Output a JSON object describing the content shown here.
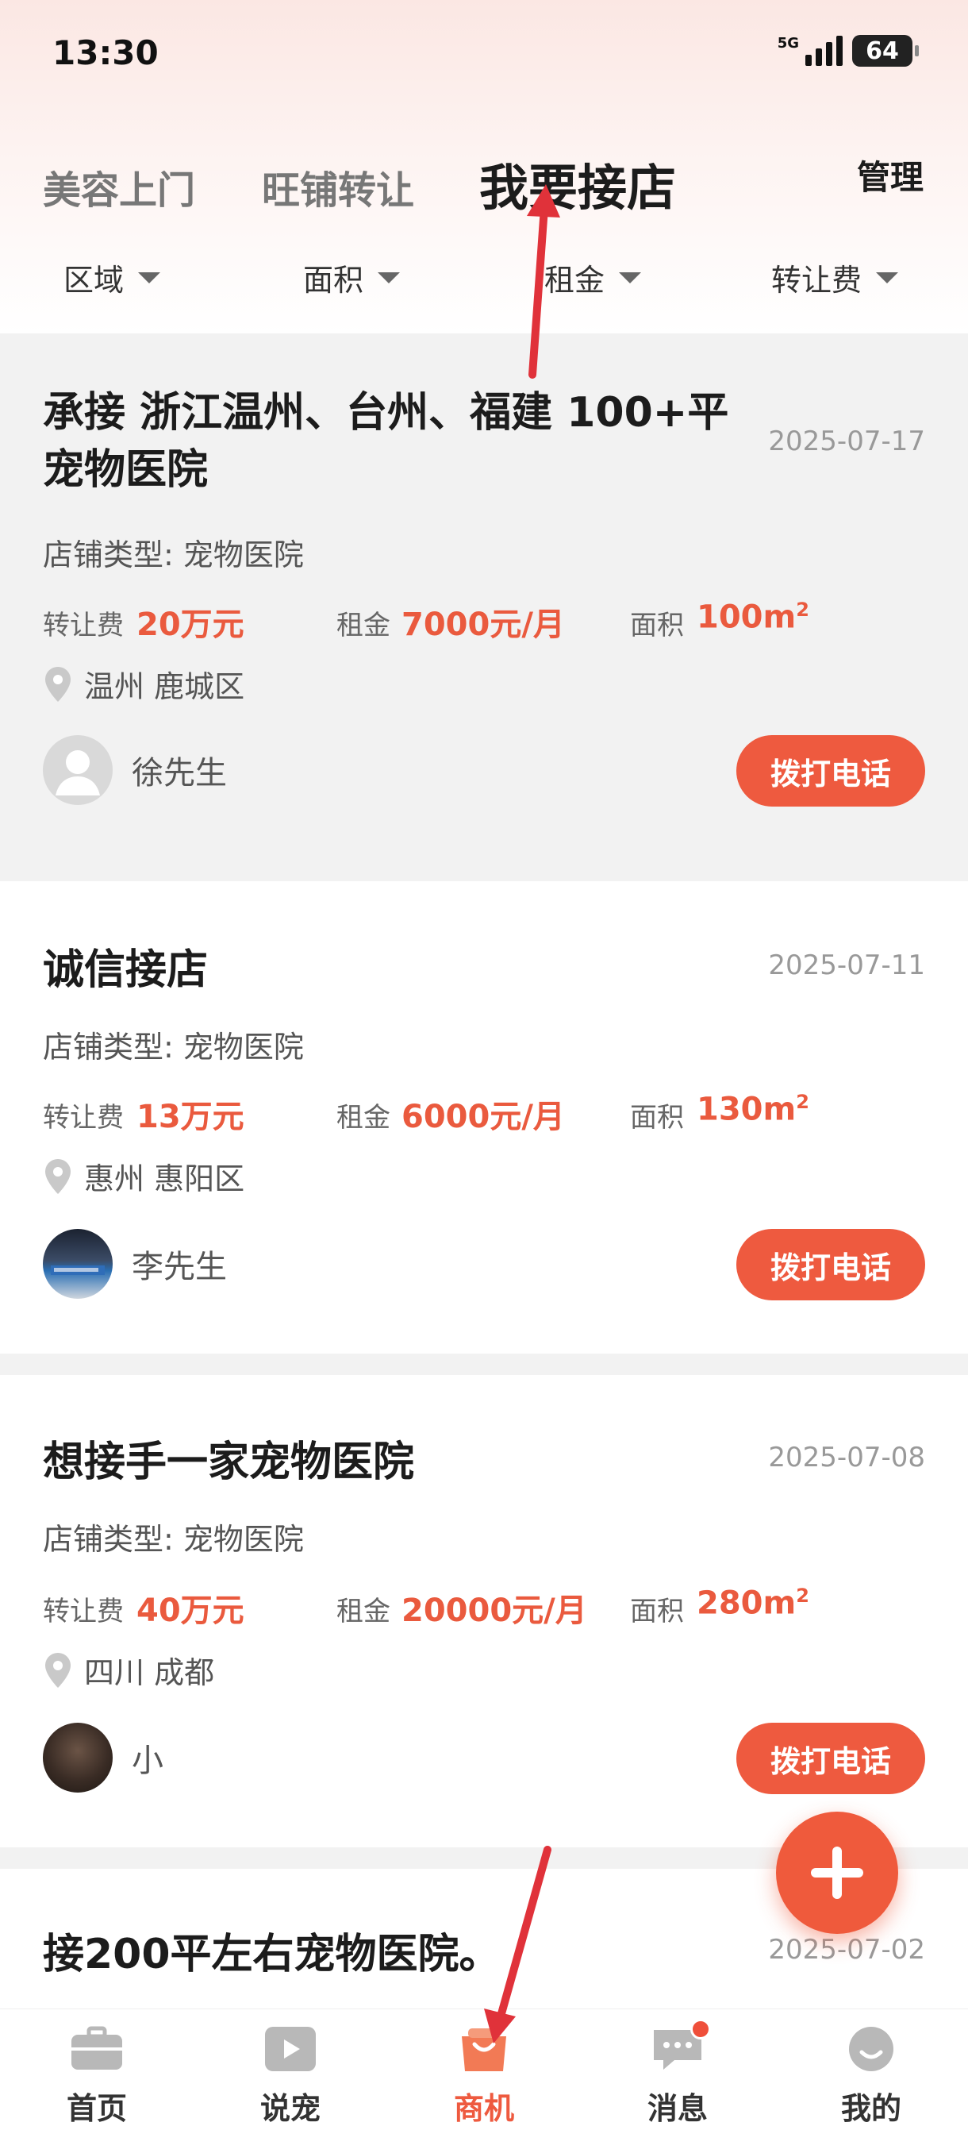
{
  "status_bar": {
    "time": "13:30",
    "network": "5G",
    "battery": "64"
  },
  "header": {
    "tabs": [
      {
        "label": "美容上门"
      },
      {
        "label": "旺铺转让"
      },
      {
        "label": "我要接店"
      }
    ],
    "manage_label": "管理"
  },
  "filters": [
    {
      "label": "区域"
    },
    {
      "label": "面积"
    },
    {
      "label": "租金"
    },
    {
      "label": "转让费"
    }
  ],
  "listings": [
    {
      "title_line1": "承接 浙江温州、台州、福建 100+平",
      "title_line2": "宠物医院",
      "date": "2025-07-17",
      "shop_type": "店铺类型: 宠物医院",
      "transfer_fee_label": "转让费",
      "transfer_fee": "20万元",
      "rent_label": "租金",
      "rent": "7000元/月",
      "area_label": "面积",
      "area": "100m",
      "area_unit_sup": "2",
      "location": "温州 鹿城区",
      "user": "徐先生",
      "call_label": "拨打电话"
    },
    {
      "title_line1": "诚信接店",
      "date": "2025-07-11",
      "shop_type": "店铺类型: 宠物医院",
      "transfer_fee_label": "转让费",
      "transfer_fee": "13万元",
      "rent_label": "租金",
      "rent": "6000元/月",
      "area_label": "面积",
      "area": "130m",
      "area_unit_sup": "2",
      "location": "惠州 惠阳区",
      "user": "李先生",
      "call_label": "拨打电话"
    },
    {
      "title_line1": "想接手一家宠物医院",
      "date": "2025-07-08",
      "shop_type": "店铺类型: 宠物医院",
      "transfer_fee_label": "转让费",
      "transfer_fee": "40万元",
      "rent_label": "租金",
      "rent": "20000元/月",
      "area_label": "面积",
      "area": "280m",
      "area_unit_sup": "2",
      "location": "四川 成都",
      "user": "小",
      "call_label": "拨打电话"
    },
    {
      "title_line1": "接200平左右宠物医院。",
      "date": "2025-07-02"
    }
  ],
  "bottom_nav": [
    {
      "label": "首页",
      "icon": "briefcase-icon"
    },
    {
      "label": "说宠",
      "icon": "play-icon"
    },
    {
      "label": "商机",
      "icon": "shopping-bag-icon"
    },
    {
      "label": "消息",
      "icon": "chat-icon"
    },
    {
      "label": "我的",
      "icon": "smiley-icon"
    }
  ],
  "colors": {
    "accent": "#ee5a3f",
    "annotation_arrow": "#e0323a"
  }
}
